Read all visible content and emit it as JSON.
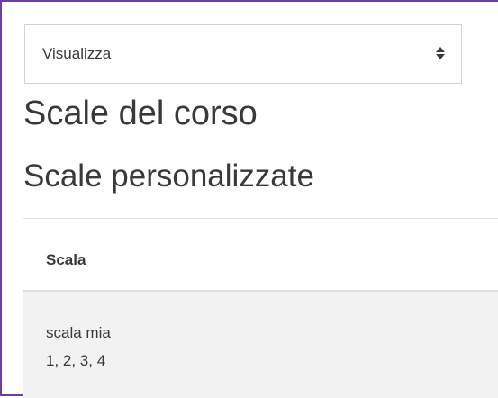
{
  "view_select": {
    "selected": "Visualizza"
  },
  "page": {
    "title": "Scale del corso"
  },
  "section": {
    "title": "Scale personalizzate"
  },
  "table": {
    "headers": [
      "Scala"
    ],
    "rows": [
      {
        "name": "scala mia",
        "items": "1, 2, 3, 4"
      }
    ]
  },
  "colors": {
    "frame_border": "#6d3f9c",
    "row_background": "#f2f2f2",
    "text": "#373a3c"
  }
}
